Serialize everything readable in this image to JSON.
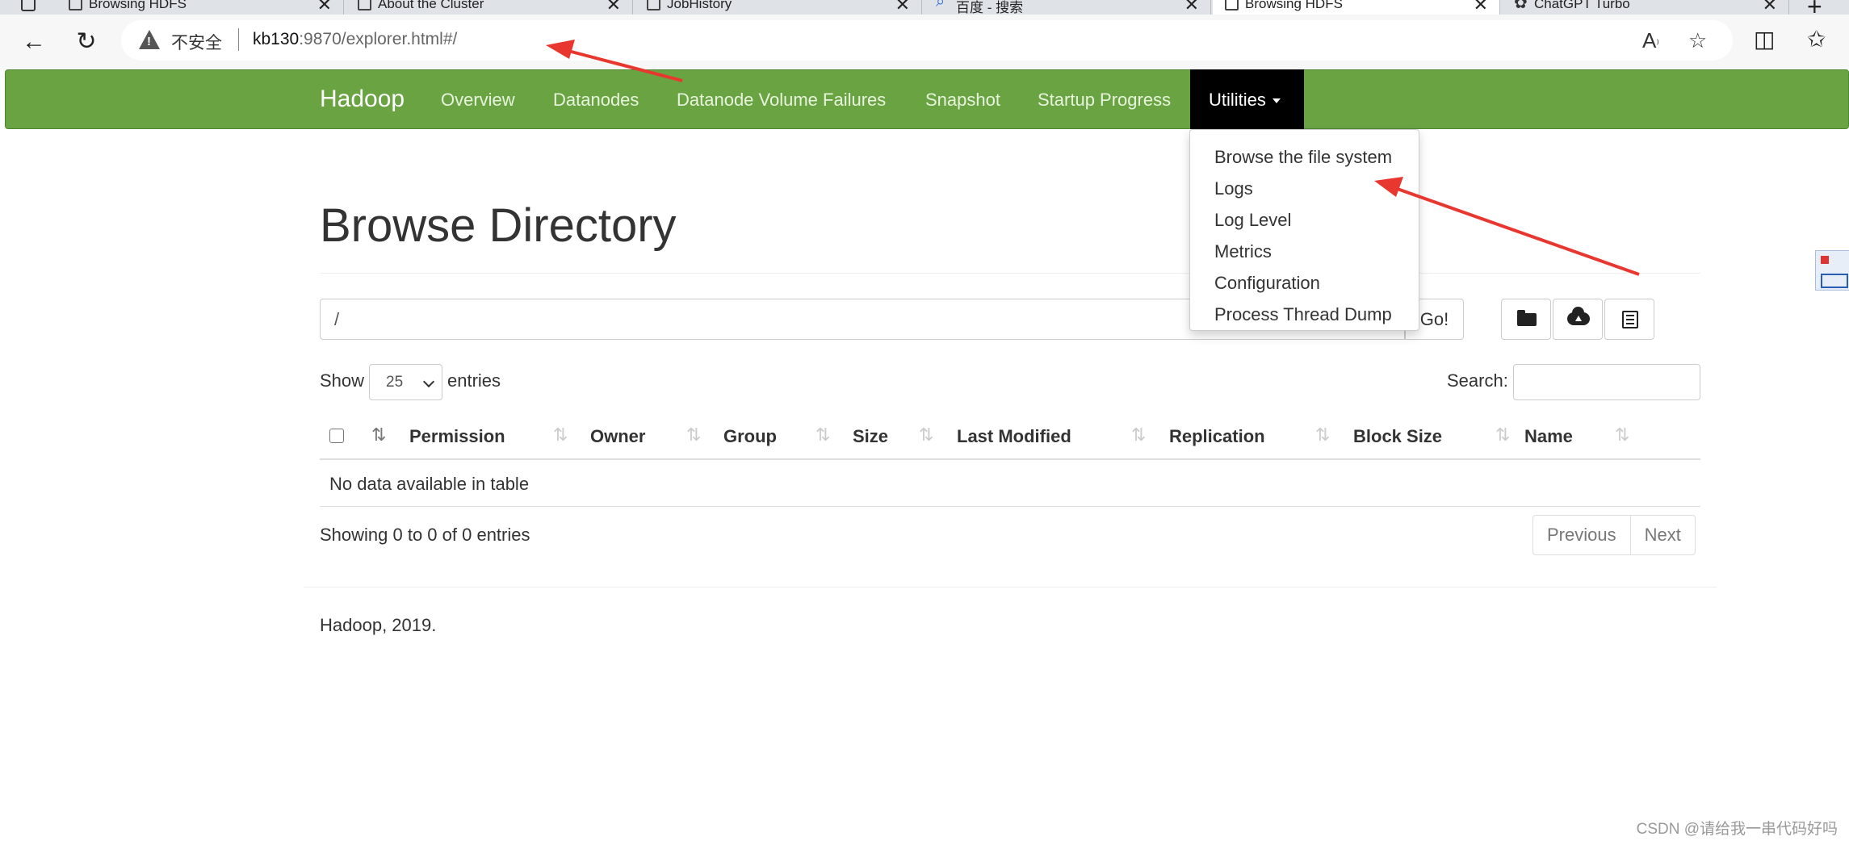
{
  "browser": {
    "tabs": [
      {
        "title": "Browsing HDFS",
        "icon": "page-icon",
        "active": false
      },
      {
        "title": "About the Cluster",
        "icon": "page-icon",
        "active": false
      },
      {
        "title": "JobHistory",
        "icon": "page-icon",
        "active": false
      },
      {
        "title": "百度 - 搜索",
        "icon": "search-icon",
        "active": false
      },
      {
        "title": "Browsing HDFS",
        "icon": "page-icon",
        "active": true
      },
      {
        "title": "ChatGPT Turbo",
        "icon": "chatgpt-icon",
        "active": false
      }
    ],
    "security_label": "不安全",
    "url_host": "kb130",
    "url_rest": ":9870/explorer.html#/"
  },
  "navbar": {
    "brand": "Hadoop",
    "links": [
      "Overview",
      "Datanodes",
      "Datanode Volume Failures",
      "Snapshot",
      "Startup Progress"
    ],
    "utilities_label": "Utilities",
    "utilities_menu": [
      "Browse the file system",
      "Logs",
      "Log Level",
      "Metrics",
      "Configuration",
      "Process Thread Dump"
    ]
  },
  "main": {
    "title": "Browse Directory",
    "path_value": "/",
    "go_label": "Go!",
    "show_label": "Show",
    "page_length": "25",
    "entries_label": "entries",
    "search_label": "Search:",
    "columns": [
      "Permission",
      "Owner",
      "Group",
      "Size",
      "Last Modified",
      "Replication",
      "Block Size",
      "Name"
    ],
    "empty_message": "No data available in table",
    "info": "Showing 0 to 0 of 0 entries",
    "previous_label": "Previous",
    "next_label": "Next",
    "footer": "Hadoop, 2019."
  },
  "watermark": "CSDN @请给我一串代码好吗",
  "colors": {
    "navbar": "#69a342",
    "active_nav": "#000000",
    "annotation_arrow": "#e8372e"
  }
}
